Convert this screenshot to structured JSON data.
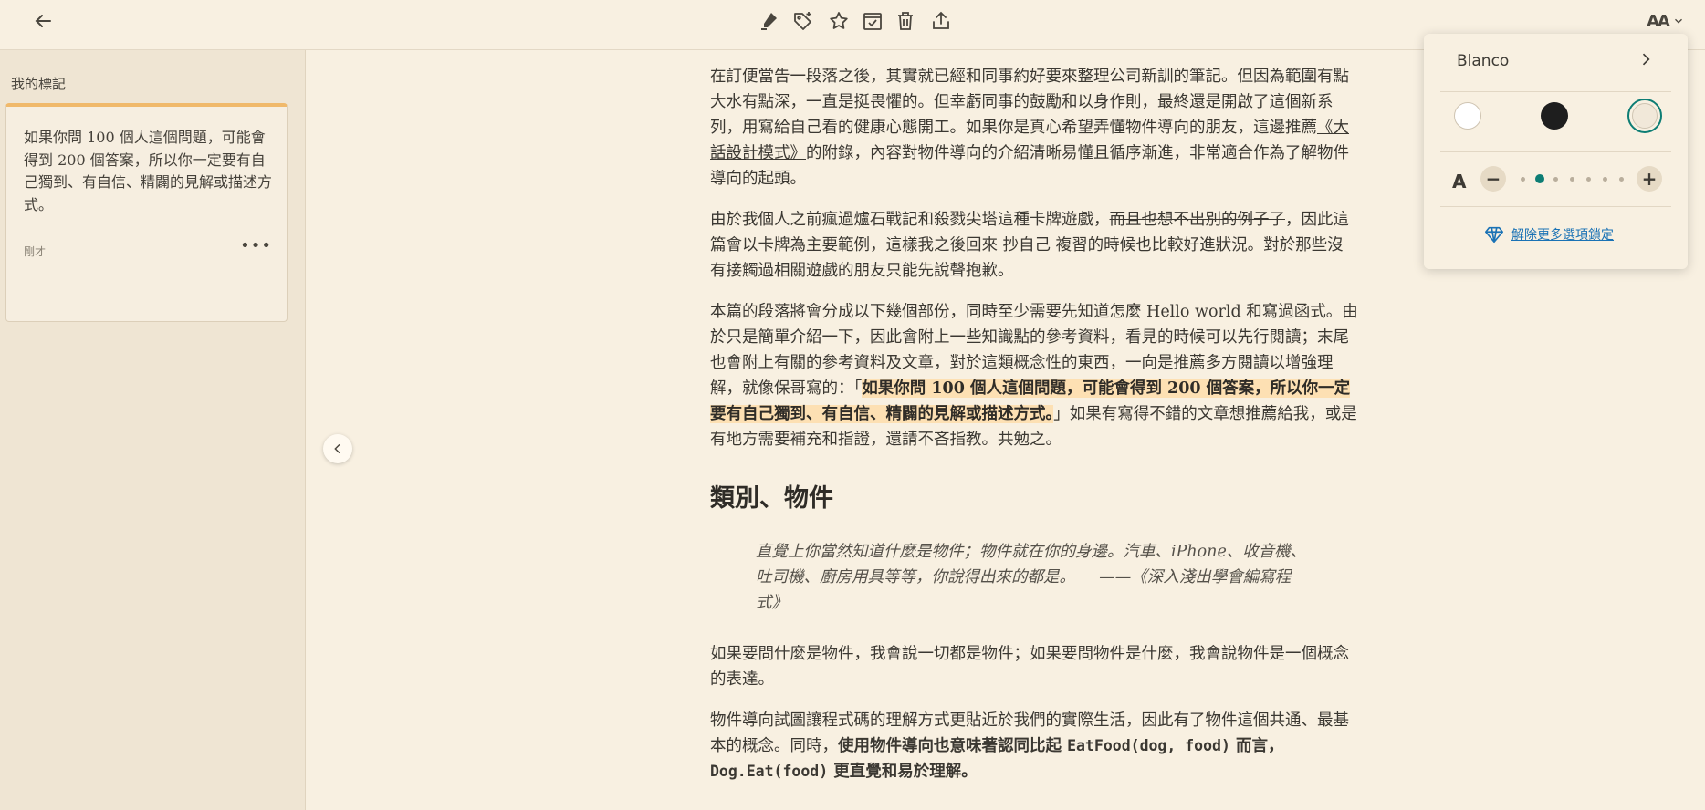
{
  "toolbar": {
    "back_icon": "back-arrow-icon",
    "tools": [
      "highlighter-icon",
      "tag-add-icon",
      "star-icon",
      "archive-icon",
      "trash-icon",
      "share-icon"
    ],
    "font_settings_label": "AA"
  },
  "sidebar": {
    "title": "我的標記",
    "notes": [
      {
        "text": "如果你問 100 個人這個問題，可能會得到 200 個答案，所以你一定要有自己獨到、有自信、精闢的見解或描述方式。",
        "time": "剛才",
        "more": "•••"
      }
    ]
  },
  "article": {
    "p1": "在訂便當告一段落之後，其實就已經和同事約好要來整理公司新訓的筆記。但因為範圍有點大水有點深，一直是挺畏懼的。但幸虧同事的鼓勵和以身作則，最終還是開啟了這個新系列，用寫給自己看的健康心態開工。如果你是真心希望弄懂物件導向的朋友，這邊推薦",
    "p1_link": "《大話設計模式》",
    "p1_end": "的附錄，內容對物件導向的介紹清晰易懂且循序漸進，非常適合作為了解物件導向的起頭。",
    "p2_a": "由於我個人之前瘋過爐石戰記和殺戮尖塔這種卡牌遊戲，",
    "p2_strike": "而且也想不出別的例子了",
    "p2_b": "，因此這篇會以卡牌為主要範例，這樣我之後回來 抄自己 複習的時候也比較好進狀況。對於那些沒有接觸過相關遊戲的朋友只能先說聲抱歉。",
    "p3_a": "本篇的段落將會分成以下幾個部份，同時至少需要先知道怎麼 Hello world 和寫過函式。由於只是簡單介紹一下，因此會附上一些知識點的參考資料，看見的時候可以先行閱讀；末尾也會附上有關的參考資料及文章，對於這類概念性的東西，一向是推薦多方閱讀以增強理解，就像保哥寫的：「",
    "p3_highlight": "如果你問 100 個人這個問題，可能會得到 200 個答案，所以你一定要有自己獨到、有自信、精闢的見解或描述方式。",
    "p3_b": "」如果有寫得不錯的文章想推薦給我，或是有地方需要補充和指證，還請不吝指教。共勉之。",
    "h2": "類別、物件",
    "quote": "直覺上你當然知道什麼是物件；物件就在你的身邊。汽車、iPhone、收音機、吐司機、廚房用具等等，你說得出來的都是。　　——《深入淺出學會編寫程式》",
    "p4": "如果要問什麼是物件，我會說一切都是物件；如果要問物件是什麼，我會說物件是一個概念的表達。",
    "p5_a": "物件導向試圖讓程式碼的理解方式更貼近於我們的實際生活，因此有了物件這個共通、最基本的概念。同時，",
    "p5_bold1": "使用物件導向也意味著認同比起 ",
    "p5_code1": "EatFood(dog, food)",
    "p5_bold2": " 而言，",
    "p5_code2": "Dog.Eat(food)",
    "p5_bold3": " 更直覺和易於理解。"
  },
  "font_popup": {
    "theme_name": "Blanco",
    "swatches": [
      "#ffffff",
      "#1e1e1e",
      "#f1e8d9"
    ],
    "active_swatch": 2,
    "size_label": "A",
    "minus": "−",
    "plus": "+",
    "size_levels": 7,
    "size_level": 2,
    "unlock_text": "解除更多選項鎖定",
    "accent": "#0d7d74",
    "link_color": "#1a72b5"
  }
}
